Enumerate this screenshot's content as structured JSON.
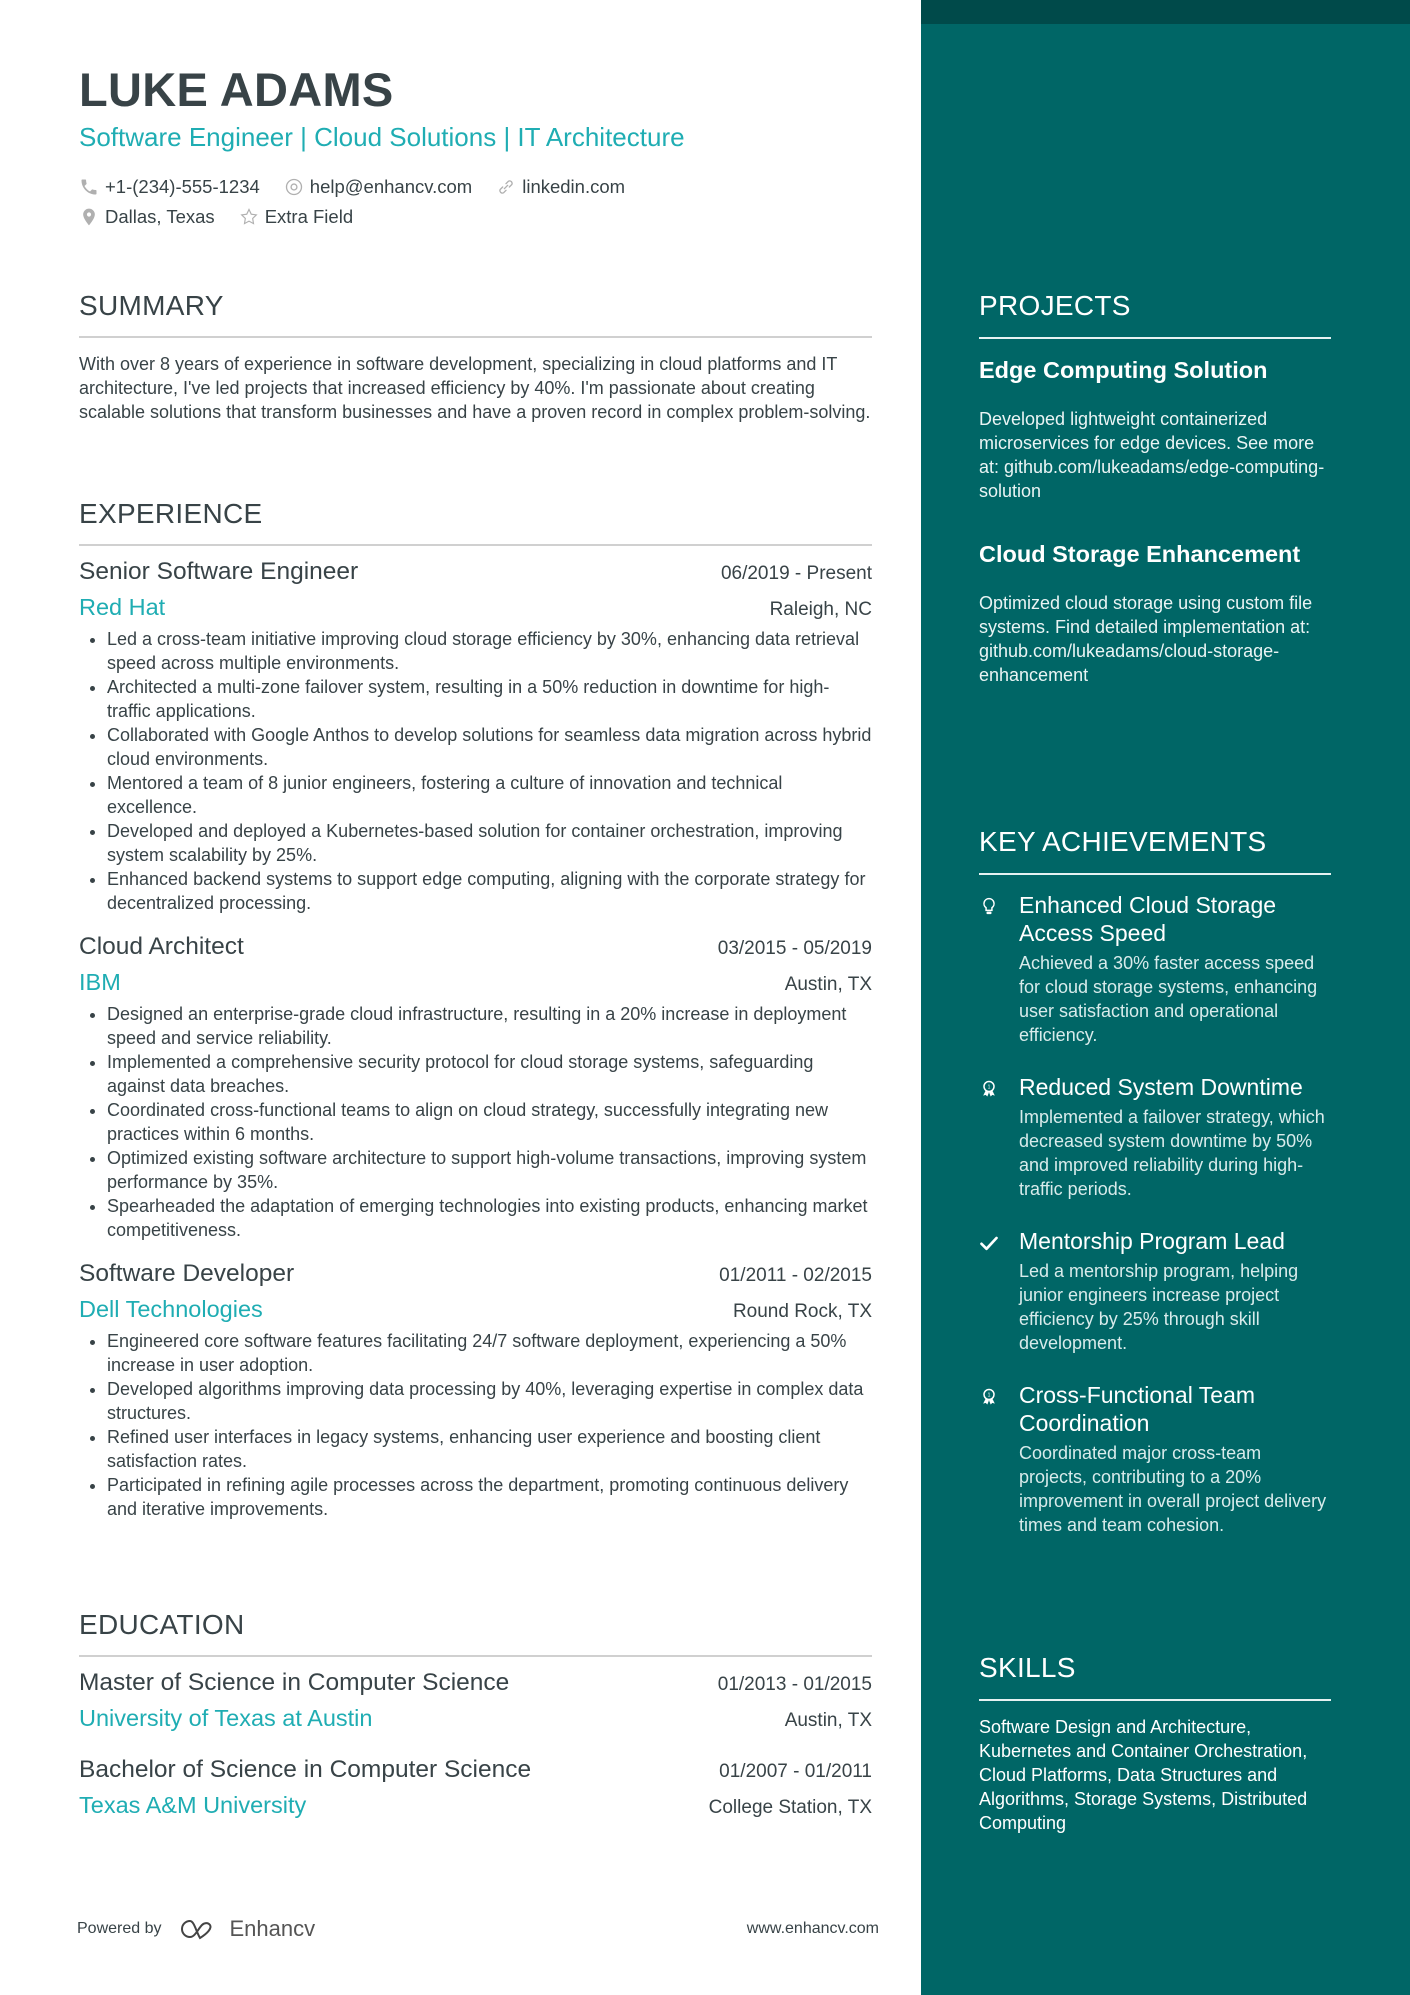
{
  "header": {
    "name": "LUKE ADAMS",
    "tagline": "Software Engineer | Cloud Solutions | IT Architecture",
    "phone": "+1-(234)-555-1234",
    "email": "help@enhancv.com",
    "link": "linkedin.com",
    "location": "Dallas, Texas",
    "extra": "Extra Field"
  },
  "summary": {
    "title": "SUMMARY",
    "text": "With over 8 years of experience in software development, specializing in cloud platforms and IT architecture, I've led projects that increased efficiency by 40%. I'm passionate about creating scalable solutions that transform businesses and have a proven record in complex problem-solving."
  },
  "experience": {
    "title": "EXPERIENCE",
    "jobs": [
      {
        "role": "Senior Software Engineer",
        "dates": "06/2019 - Present",
        "company": "Red Hat",
        "location": "Raleigh, NC",
        "bullets": [
          "Led a cross-team initiative improving cloud storage efficiency by 30%, enhancing data retrieval speed across multiple environments.",
          "Architected a multi-zone failover system, resulting in a 50% reduction in downtime for high-traffic applications.",
          "Collaborated with Google Anthos to develop solutions for seamless data migration across hybrid cloud environments.",
          "Mentored a team of 8 junior engineers, fostering a culture of innovation and technical excellence.",
          "Developed and deployed a Kubernetes-based solution for container orchestration, improving system scalability by 25%.",
          "Enhanced backend systems to support edge computing, aligning with the corporate strategy for decentralized processing."
        ]
      },
      {
        "role": "Cloud Architect",
        "dates": "03/2015 - 05/2019",
        "company": "IBM",
        "location": "Austin, TX",
        "bullets": [
          "Designed an enterprise-grade cloud infrastructure, resulting in a 20% increase in deployment speed and service reliability.",
          "Implemented a comprehensive security protocol for cloud storage systems, safeguarding against data breaches.",
          "Coordinated cross-functional teams to align on cloud strategy, successfully integrating new practices within 6 months.",
          "Optimized existing software architecture to support high-volume transactions, improving system performance by 35%.",
          "Spearheaded the adaptation of emerging technologies into existing products, enhancing market competitiveness."
        ]
      },
      {
        "role": "Software Developer",
        "dates": "01/2011 - 02/2015",
        "company": "Dell Technologies",
        "location": "Round Rock, TX",
        "bullets": [
          "Engineered core software features facilitating 24/7 software deployment, experiencing a 50% increase in user adoption.",
          "Developed algorithms improving data processing by 40%, leveraging expertise in complex data structures.",
          "Refined user interfaces in legacy systems, enhancing user experience and boosting client satisfaction rates.",
          "Participated in refining agile processes across the department, promoting continuous delivery and iterative improvements."
        ]
      }
    ]
  },
  "education": {
    "title": "EDUCATION",
    "items": [
      {
        "degree": "Master of Science in Computer Science",
        "dates": "01/2013 - 01/2015",
        "school": "University of Texas at Austin",
        "location": "Austin, TX"
      },
      {
        "degree": "Bachelor of Science in Computer Science",
        "dates": "01/2007 - 01/2011",
        "school": "Texas A&M University",
        "location": "College Station, TX"
      }
    ]
  },
  "projects": {
    "title": "PROJECTS",
    "items": [
      {
        "title": "Edge Computing Solution",
        "desc": "Developed lightweight containerized microservices for edge devices. See more at: github.com/lukeadams/edge-computing-solution"
      },
      {
        "title": "Cloud Storage Enhancement",
        "desc": "Optimized cloud storage using custom file systems. Find detailed implementation at: github.com/lukeadams/cloud-storage-enhancement"
      }
    ]
  },
  "achievements": {
    "title": "KEY ACHIEVEMENTS",
    "items": [
      {
        "icon": "lightbulb-icon",
        "title": "Enhanced Cloud Storage Access Speed",
        "desc": "Achieved a 30% faster access speed for cloud storage systems, enhancing user satisfaction and operational efficiency."
      },
      {
        "icon": "award-icon",
        "title": "Reduced System Downtime",
        "desc": "Implemented a failover strategy, which decreased system downtime by 50% and improved reliability during high-traffic periods."
      },
      {
        "icon": "checkmark-icon",
        "title": "Mentorship Program Lead",
        "desc": "Led a mentorship program, helping junior engineers increase project efficiency by 25% through skill development."
      },
      {
        "icon": "award-icon",
        "title": "Cross-Functional Team Coordination",
        "desc": "Coordinated major cross-team projects, contributing to a 20% improvement in overall project delivery times and team cohesion."
      }
    ]
  },
  "skills": {
    "title": "SKILLS",
    "text": "Software Design and Architecture, Kubernetes and Container Orchestration, Cloud Platforms, Data Structures and Algorithms, Storage Systems, Distributed Computing"
  },
  "footer": {
    "powered_by": "Powered by",
    "brand": "Enhancv",
    "website": "www.enhancv.com"
  },
  "colors": {
    "accent": "#1fadb3",
    "sidebar": "#006666",
    "sidebar_top": "#004a4a",
    "text": "#384347"
  }
}
